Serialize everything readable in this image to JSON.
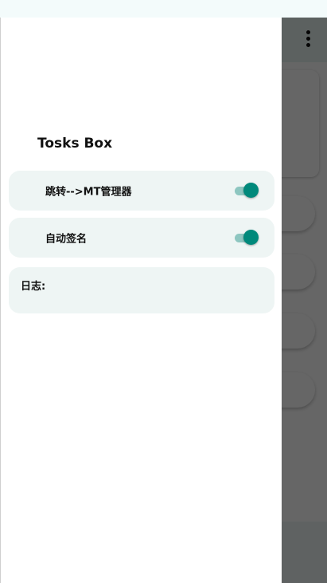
{
  "drawer": {
    "title": "Tosks Box",
    "settings": [
      {
        "label": "跳转-->MT管理器",
        "enabled": true
      },
      {
        "label": "自动签名",
        "enabled": true
      }
    ],
    "log": {
      "label": "日志:",
      "content": ""
    }
  },
  "icons": {
    "overflow": "more-vert-icon"
  },
  "colors": {
    "accent": "#00897b",
    "switch_track": "#8dc6c0",
    "card_background": "#eef5f4",
    "scrim": "rgba(0,0,0,0.6)"
  }
}
